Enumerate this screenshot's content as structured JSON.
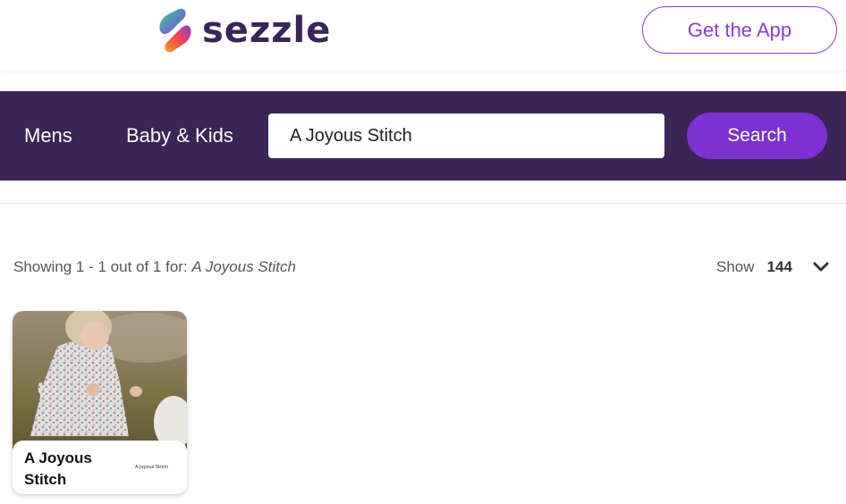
{
  "header": {
    "logo_text": "sezzle",
    "get_app_label": "Get the App"
  },
  "nav": {
    "items": [
      {
        "label": "Mens"
      },
      {
        "label": "Baby & Kids"
      }
    ],
    "search": {
      "value": "A Joyous Stitch",
      "button_label": "Search"
    }
  },
  "results": {
    "showing_text": "Showing 1 - 1 out of 1 for: ",
    "query": "A Joyous Stitch",
    "show_label": "Show",
    "show_count": "144"
  },
  "cards": [
    {
      "name": "A Joyous Stitch",
      "logo_text": "A Joyous Stitch"
    }
  ],
  "colors": {
    "brand_purple": "#392558",
    "nav_bg": "#3b2456",
    "accent": "#7d31d1"
  }
}
